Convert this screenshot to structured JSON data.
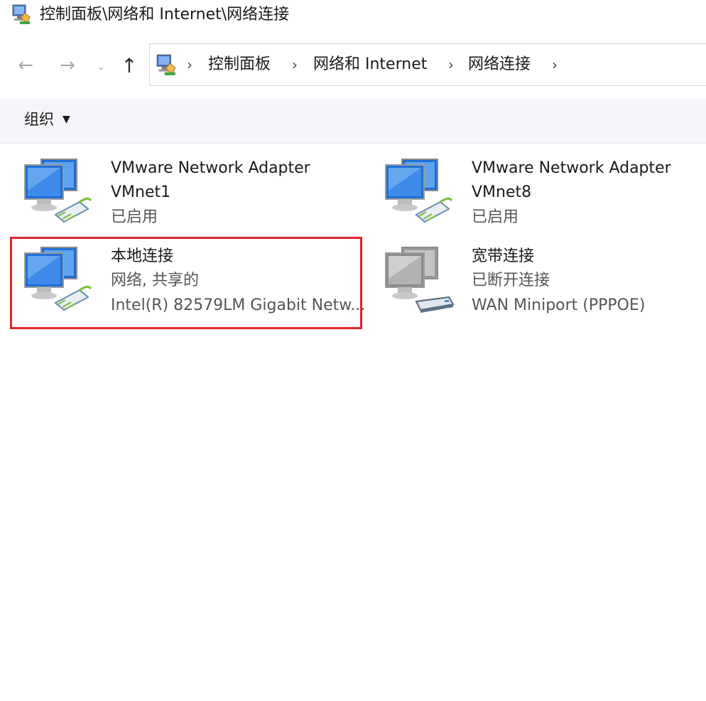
{
  "window": {
    "title": "控制面板\\网络和 Internet\\网络连接"
  },
  "nav": {
    "back_glyph": "←",
    "forward_glyph": "→",
    "recent_glyph": "⌄",
    "up_glyph": "↑"
  },
  "breadcrumb": {
    "separator": "›",
    "items": [
      "控制面板",
      "网络和 Internet",
      "网络连接"
    ]
  },
  "commandbar": {
    "organize_label": "组织",
    "caret": "▼"
  },
  "connections": [
    {
      "name": "VMware Network Adapter",
      "line2": "VMnet1",
      "line3": "已启用",
      "icon": "network-adapter-icon"
    },
    {
      "name": "VMware Network Adapter",
      "line2": "VMnet8",
      "line3": "已启用",
      "icon": "network-adapter-icon"
    },
    {
      "name": "本地连接",
      "line2": "网络, 共享的",
      "line3": "Intel(R) 82579LM Gigabit Netw...",
      "icon": "network-adapter-icon"
    },
    {
      "name": "宽带连接",
      "line2": "已断开连接",
      "line3": "WAN Miniport (PPPOE)",
      "icon": "broadband-modem-icon"
    }
  ],
  "colors": {
    "highlight": "#e0262b",
    "commandbar_bg": "#f3f5f8",
    "monitor_blue": "#1f6fd6",
    "cable_green": "#7bbf3a"
  }
}
